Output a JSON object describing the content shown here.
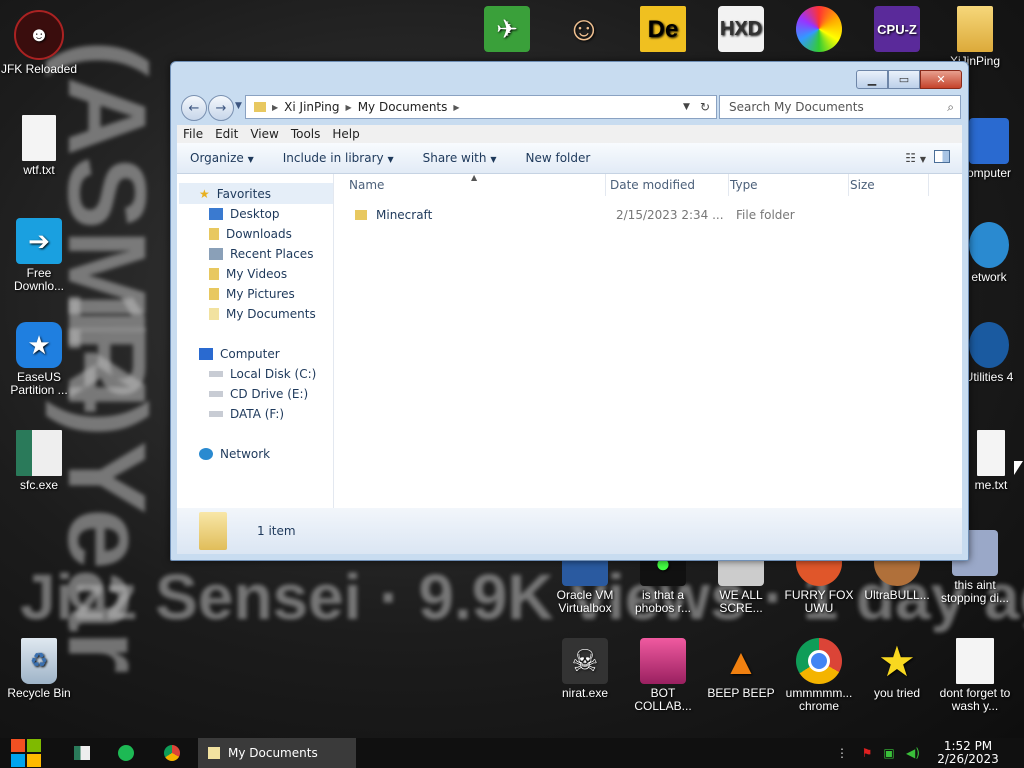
{
  "wallpaper": {
    "text_large": "(ASMR)",
    "text_year": "14 Year",
    "text_bottom": "Jizz Sensei · 9.9K views · 1 day ago"
  },
  "desktop_icons": {
    "left": [
      {
        "label": "JFK Reloaded",
        "icon": "jfk-icon"
      },
      {
        "label": "wtf.txt",
        "icon": "text-file-icon"
      },
      {
        "label": "Free Downlo...",
        "icon": "download-arrow-icon"
      },
      {
        "label": "EaseUS Partition ...",
        "icon": "easeus-icon"
      },
      {
        "label": "sfc.exe",
        "icon": "exe-icon"
      },
      {
        "label": "Recycle Bin",
        "icon": "recycle-bin-icon"
      }
    ],
    "top": [
      {
        "label": "",
        "icon": "plane-icon"
      },
      {
        "label": "",
        "icon": "doctor-icon"
      },
      {
        "label": "",
        "icon": "de-icon"
      },
      {
        "label": "",
        "icon": "hxd-icon"
      },
      {
        "label": "",
        "icon": "color-wheel-icon"
      },
      {
        "label": "",
        "icon": "cpuz-icon"
      },
      {
        "label": "XiJinPing",
        "icon": "user-folder-icon"
      }
    ],
    "right": [
      {
        "label": "omputer",
        "icon": "computer-icon"
      },
      {
        "label": "etwork",
        "icon": "network-icon"
      },
      {
        "label": "Utilities 4",
        "icon": "utilities-icon"
      },
      {
        "label": "me.txt",
        "icon": "text-file-icon"
      }
    ],
    "bottom_row1": [
      {
        "label": "Oracle VM Virtualbox",
        "icon": "virtualbox-icon"
      },
      {
        "label": "is that a phobos r...",
        "icon": "phobos-icon"
      },
      {
        "label": "WE ALL SCRE...",
        "icon": "scream-icon"
      },
      {
        "label": "FURRY FOX UWU",
        "icon": "fox-icon"
      },
      {
        "label": "UltraBULL...",
        "icon": "ultrabull-icon"
      },
      {
        "label": "this aint stopping di...",
        "icon": "stopping-icon"
      }
    ],
    "bottom_row2": [
      {
        "label": "nirat.exe",
        "icon": "skull-icon"
      },
      {
        "label": "BOT COLLAB...",
        "icon": "bot-monitor-icon"
      },
      {
        "label": "BEEP BEEP",
        "icon": "vlc-cone-icon"
      },
      {
        "label": "ummmmm... chrome",
        "icon": "chrome-icon"
      },
      {
        "label": "you tried",
        "icon": "star-icon"
      },
      {
        "label": "dont forget to wash y...",
        "icon": "calendar-icon"
      }
    ]
  },
  "window": {
    "breadcrumb": [
      "Xi JinPing",
      "My Documents"
    ],
    "search_placeholder": "Search My Documents",
    "menu": [
      "File",
      "Edit",
      "View",
      "Tools",
      "Help"
    ],
    "toolbar": {
      "organize": "Organize",
      "include": "Include in library",
      "share": "Share with",
      "new_folder": "New folder"
    },
    "nav": {
      "favorites": "Favorites",
      "desktop": "Desktop",
      "downloads": "Downloads",
      "recent": "Recent Places",
      "videos": "My Videos",
      "pictures": "My Pictures",
      "documents": "My Documents",
      "computer": "Computer",
      "local_disk": "Local Disk (C:)",
      "cd_drive": "CD Drive (E:)",
      "data": "DATA (F:)",
      "network": "Network"
    },
    "columns": {
      "name": "Name",
      "date": "Date modified",
      "type": "Type",
      "size": "Size"
    },
    "files": [
      {
        "name": "Minecraft",
        "date": "2/15/2023 2:34 ...",
        "type": "File folder",
        "size": ""
      }
    ],
    "status": "1 item"
  },
  "taskbar": {
    "active_window": "My Documents",
    "time": "1:52 PM",
    "date": "2/26/2023"
  }
}
